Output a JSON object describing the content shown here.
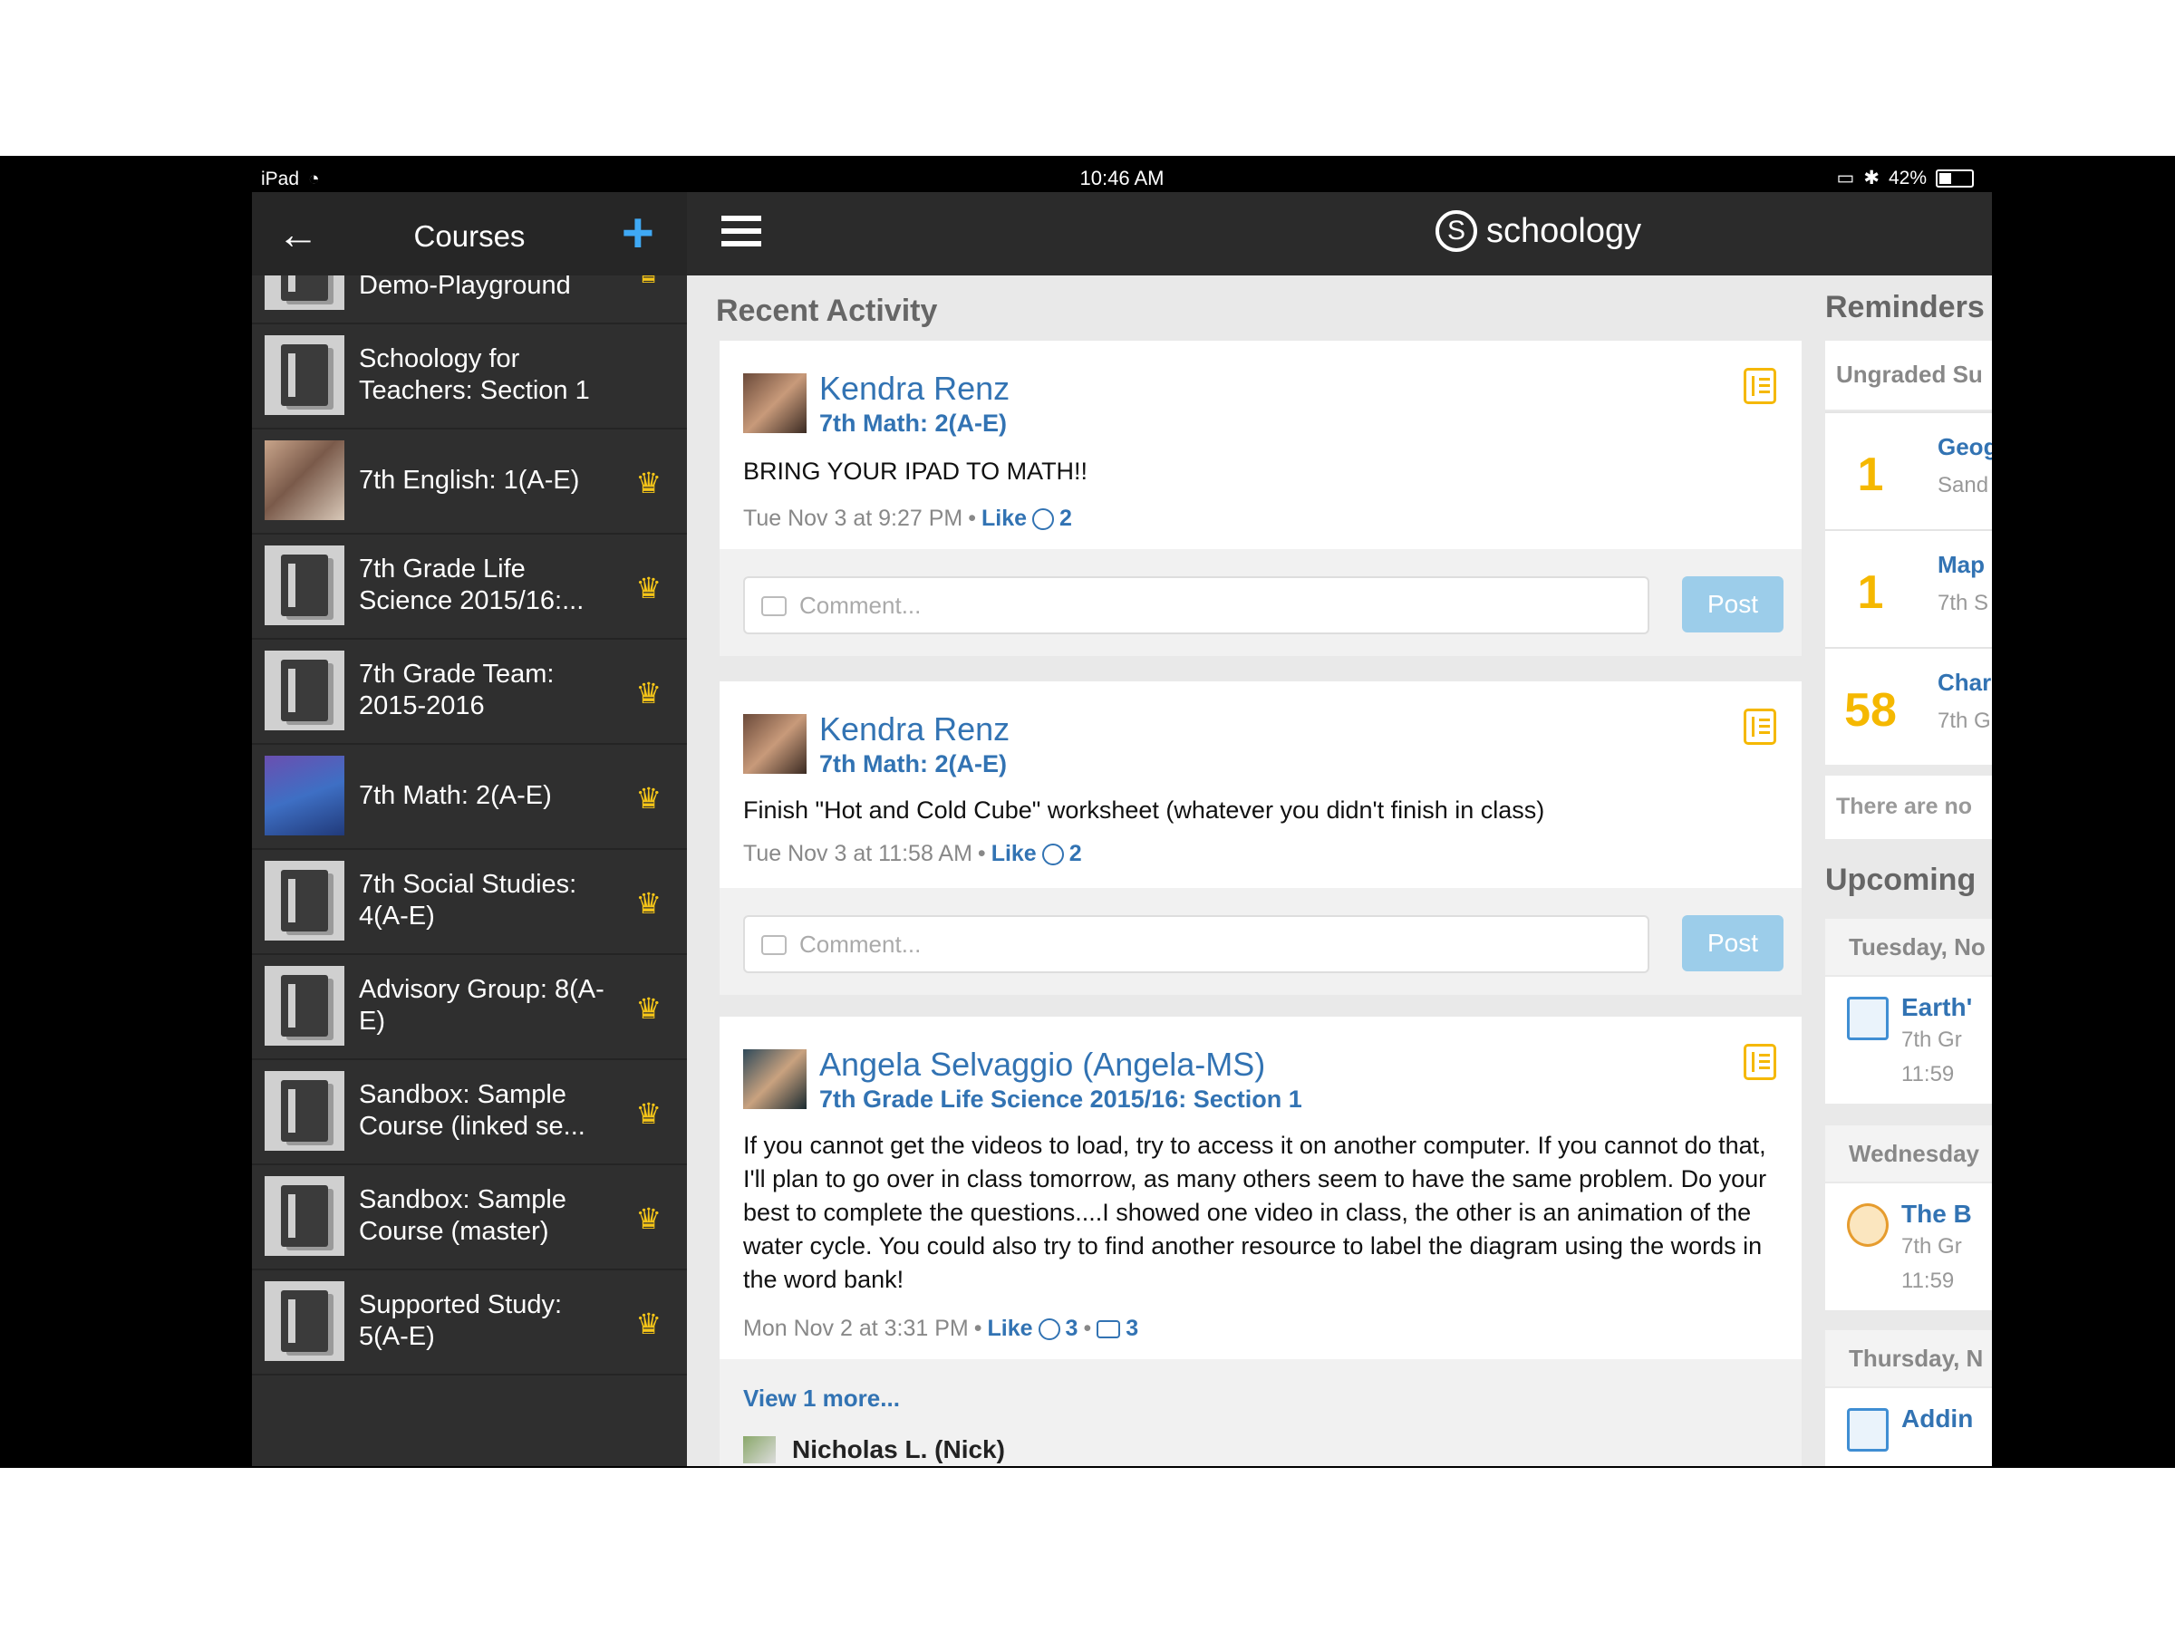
{
  "status_bar": {
    "device": "iPad",
    "time": "10:46 AM",
    "battery": "42%",
    "battery_level": 0.42
  },
  "left_panel": {
    "title": "Courses",
    "courses": [
      {
        "name": "Sandbox: UPS Demo-Playground",
        "thumb": "book",
        "admin": true
      },
      {
        "name": "Schoology for Teachers: Section 1",
        "thumb": "book",
        "admin": false
      },
      {
        "name": "7th English: 1(A-E)",
        "thumb": "photo",
        "admin": true
      },
      {
        "name": "7th Grade Life Science 2015/16:...",
        "thumb": "book",
        "admin": true
      },
      {
        "name": "7th Grade Team: 2015-2016",
        "thumb": "book",
        "admin": true
      },
      {
        "name": "7th Math: 2(A-E)",
        "thumb": "math",
        "admin": true
      },
      {
        "name": "7th Social Studies: 4(A-E)",
        "thumb": "book",
        "admin": true
      },
      {
        "name": "Advisory Group: 8(A-E)",
        "thumb": "book",
        "admin": true
      },
      {
        "name": "Sandbox: Sample Course (linked se...",
        "thumb": "book",
        "admin": true
      },
      {
        "name": "Sandbox: Sample Course (master)",
        "thumb": "book",
        "admin": true
      },
      {
        "name": "Supported Study: 5(A-E)",
        "thumb": "book",
        "admin": true
      }
    ]
  },
  "header": {
    "logo_text": "schoology",
    "logo_letter": "S"
  },
  "feed": {
    "title": "Recent Activity",
    "comment_placeholder": "Comment...",
    "post_label": "Post",
    "like_label": "Like",
    "posts": [
      {
        "author": "Kendra Renz",
        "course": "7th Math: 2(A-E)",
        "body": "BRING YOUR IPAD TO MATH!!",
        "time": "Tue Nov 3 at 9:27 PM",
        "likes": "2"
      },
      {
        "author": "Kendra Renz",
        "course": "7th Math: 2(A-E)",
        "body": "Finish \"Hot and Cold Cube\" worksheet (whatever you didn't finish in class)",
        "time": "Tue Nov 3 at 11:58 AM",
        "likes": "2"
      },
      {
        "author": "Angela Selvaggio (Angela-MS)",
        "course": "7th Grade Life Science 2015/16: Section 1",
        "body": "If you cannot get the videos to load, try to access it on another computer.  If you cannot do that, I'll plan to go over in class tomorrow, as many others seem to have the same problem.  Do your best to complete the questions....I showed one video in class, the other is an animation of the water cycle.  You could also try to find another resource to label the diagram using the words in the word bank!",
        "time": "Mon Nov 2 at 3:31 PM",
        "likes": "3",
        "comments": "3"
      }
    ],
    "view_more": "View 1 more...",
    "reply_author": "Nicholas L. (Nick)"
  },
  "right_col": {
    "reminders_title": "Reminders",
    "ungraded_head": "Ungraded Su",
    "reminders": [
      {
        "count": "1",
        "title": "Geog",
        "sub": "Sand"
      },
      {
        "count": "1",
        "title": "Map",
        "sub": "7th S"
      },
      {
        "count": "58",
        "title": "Char",
        "sub": "7th G"
      }
    ],
    "note": "There are no",
    "upcoming_title": "Upcoming",
    "days": [
      {
        "head": "Tuesday, No",
        "event": "Earth'",
        "sub": "7th Gr",
        "time": "11:59"
      },
      {
        "head": "Wednesday",
        "event": "The B",
        "sub": "7th Gr",
        "time": "11:59"
      },
      {
        "head": "Thursday, N",
        "event": "Addin"
      }
    ]
  },
  "colors": {
    "link": "#3273b3",
    "accent": "#f5b800",
    "add_button": "#3fa9f5",
    "post_button": "#9ccdea"
  }
}
